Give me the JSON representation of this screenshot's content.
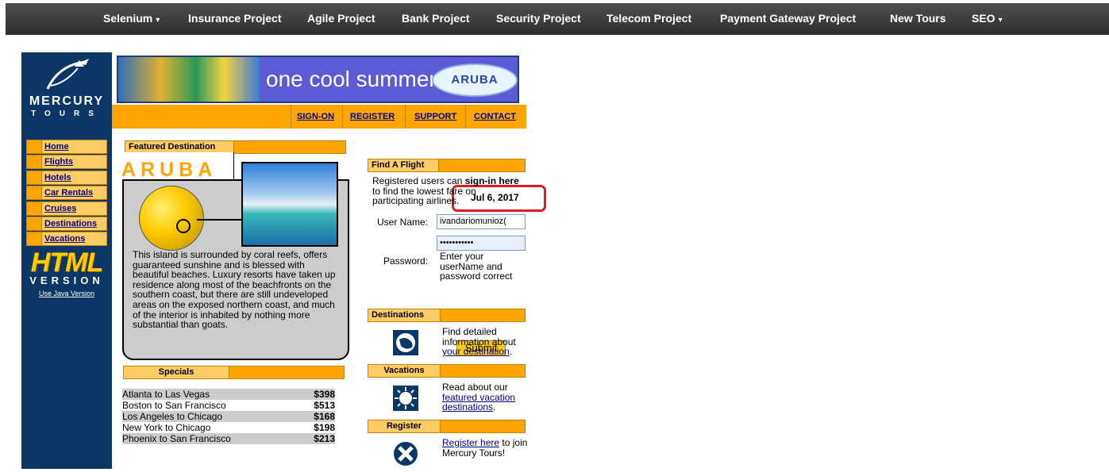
{
  "topnav": {
    "items": [
      {
        "label": "Selenium",
        "caret": "▾"
      },
      {
        "label": "Insurance Project"
      },
      {
        "label": "Agile Project"
      },
      {
        "label": "Bank Project"
      },
      {
        "label": "Security Project"
      },
      {
        "label": "Telecom Project"
      },
      {
        "label": "Payment Gateway Project"
      },
      {
        "label": "New Tours"
      },
      {
        "label": "SEO",
        "caret": "▾"
      }
    ]
  },
  "logo": {
    "line1": "MERCURY",
    "line2": "TOURS"
  },
  "banner": {
    "tagline": "one cool summer",
    "brand": "ARUBA"
  },
  "topmenu": {
    "signon": "SIGN-ON",
    "register": "REGISTER",
    "support": "SUPPORT",
    "contact": "CONTACT"
  },
  "leftmenu": [
    "Home",
    "Flights",
    "Hotels",
    "Car Rentals",
    "Cruises",
    "Destinations",
    "Vacations"
  ],
  "html_logo": {
    "big": "HTML",
    "version": "VERSION",
    "java_link": "Use Java Version"
  },
  "featured": {
    "header": "Featured Destination",
    "title": "ARUBA",
    "description": "This island is surrounded by coral reefs, offers guaranteed sunshine and is blessed with beautiful beaches. Luxury resorts have taken up residence along most of the beachfronts on the southern coast, but there are still undeveloped areas on the exposed northern coast, and much of the interior is inhabited by nothing more substantial than goats."
  },
  "specials": {
    "header": "Specials",
    "rows": [
      {
        "route": "Atlanta to Las Vegas",
        "price": "$398"
      },
      {
        "route": "Boston to San Francisco",
        "price": "$513"
      },
      {
        "route": "Los Angeles to Chicago",
        "price": "$168"
      },
      {
        "route": "New York to Chicago",
        "price": "$198"
      },
      {
        "route": "Phoenix to San Francisco",
        "price": "$213"
      }
    ]
  },
  "date": "Jul 6, 2017",
  "find_flight": {
    "header": "Find A Flight",
    "intro_pre": "Registered users can ",
    "intro_bold": "sign-in here",
    "intro_post": " to find the lowest fare on participating airlines.",
    "username_label": "User Name:",
    "username_value": "ivandariomunioz(",
    "password_label": "Password:",
    "password_value": "•••••••••••",
    "error": "Enter your userName and password correct",
    "submit": "Submit"
  },
  "destinations": {
    "header": "Destinations",
    "text_pre": "Find detailed information about ",
    "link": "your destination",
    "text_post": "."
  },
  "vacations": {
    "header": "Vacations",
    "text_pre": "Read about our ",
    "link": "featured vacation destinations",
    "text_post": "."
  },
  "register_panel": {
    "header": "Register",
    "link": "Register here",
    "text_post": " to join Mercury Tours!"
  }
}
